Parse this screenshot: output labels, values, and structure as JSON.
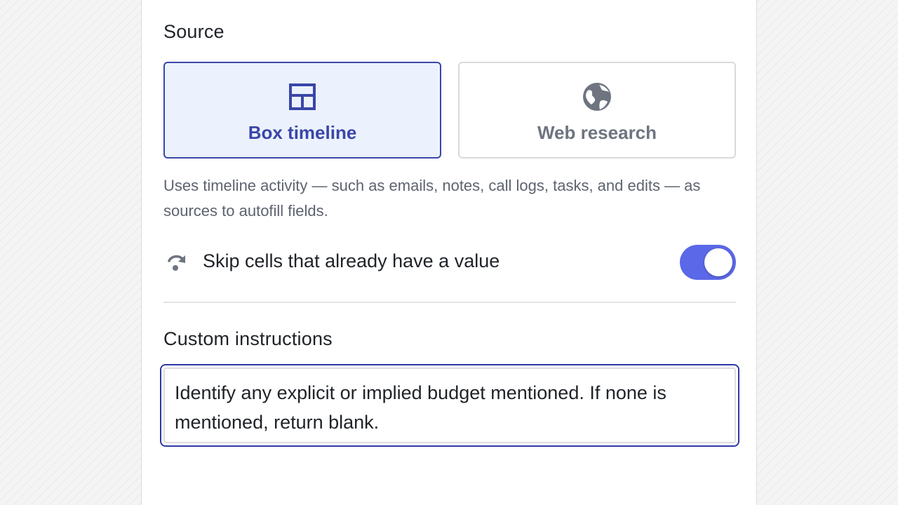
{
  "source_section": {
    "title": "Source",
    "options": [
      {
        "label": "Box timeline",
        "icon": "layout-icon",
        "selected": true
      },
      {
        "label": "Web research",
        "icon": "globe-icon",
        "selected": false
      }
    ],
    "description": "Uses timeline activity — such as emails, notes, call logs, tasks, and edits — as sources to autofill fields."
  },
  "skip_setting": {
    "label": "Skip cells that already have a value",
    "icon": "redo-skip-icon",
    "enabled": true
  },
  "custom_instructions": {
    "title": "Custom instructions",
    "value": "Identify any explicit or implied budget mentioned. If none is mentioned, return blank."
  },
  "colors": {
    "accent": "#3b46a8",
    "selected_card_bg": "#ebf2fd",
    "toggle_on": "#5b68e8",
    "focus_border": "#2f38a6"
  }
}
